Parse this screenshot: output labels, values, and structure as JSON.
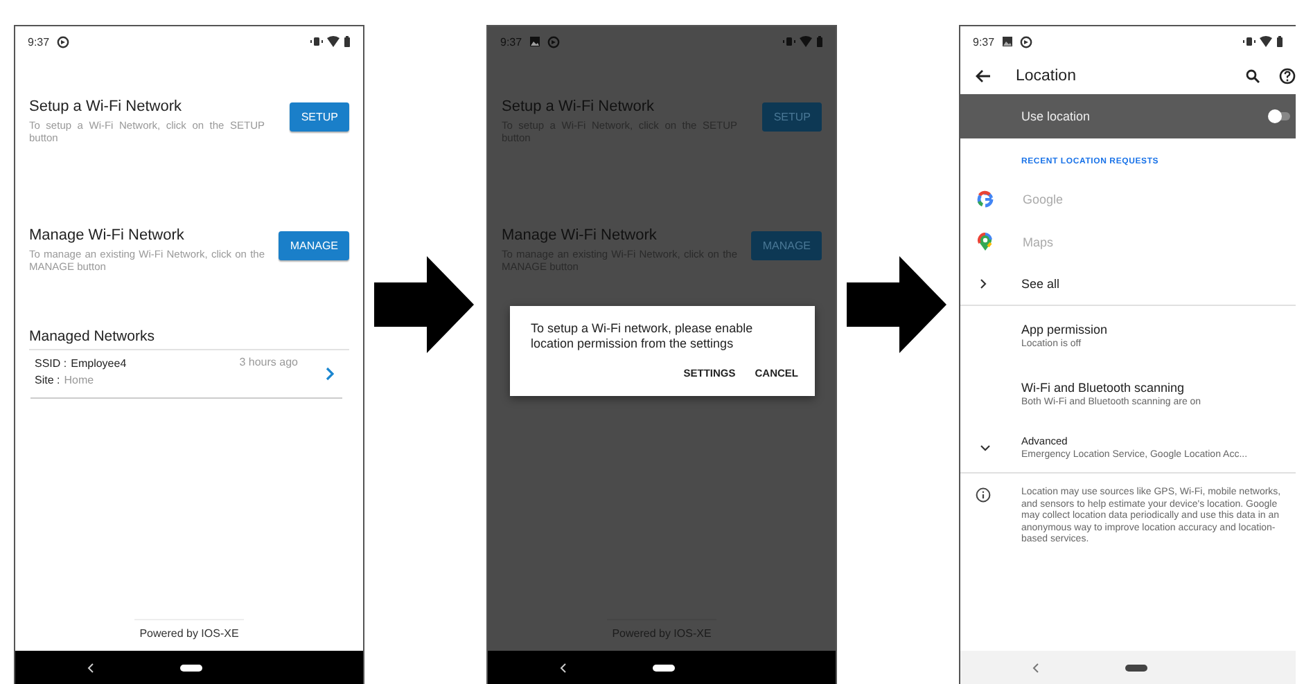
{
  "screens": [
    {
      "kind": "app",
      "dimmed": false,
      "status_bar": {
        "time": "9:37",
        "image_notification": false
      },
      "sections": [
        {
          "title": "Setup a Wi-Fi Network",
          "description": "To setup a Wi-Fi Network, click on the SETUP button",
          "button": "SETUP"
        },
        {
          "title": "Manage Wi-Fi Network",
          "description": "To manage an existing Wi-Fi Network, click on the MANAGE button",
          "button": "MANAGE"
        }
      ],
      "managed": {
        "title": "Managed Networks",
        "items": [
          {
            "ssid_label": "SSID :",
            "ssid": "Employee4",
            "site_label": "Site :",
            "site": "Home",
            "time": "3 hours ago"
          }
        ]
      },
      "footer": "Powered by IOS-XE"
    },
    {
      "kind": "app",
      "dimmed": true,
      "status_bar": {
        "time": "9:37",
        "image_notification": true
      },
      "sections": [
        {
          "title": "Setup a Wi-Fi Network",
          "description": "To setup a Wi-Fi Network, click on the SETUP button",
          "button": "SETUP"
        },
        {
          "title": "Manage Wi-Fi Network",
          "description": "To manage an existing Wi-Fi Network, click on the MANAGE button",
          "button": "MANAGE"
        }
      ],
      "dialog": {
        "message": "To setup a Wi-Fi network, please enable location permission from the settings",
        "buttons": [
          "SETTINGS",
          "CANCEL"
        ]
      },
      "footer": "Powered by IOS-XE"
    },
    {
      "kind": "settings",
      "status_bar": {
        "time": "9:37",
        "image_notification": true
      },
      "title": "Location",
      "use_location": {
        "label": "Use location",
        "on": false
      },
      "section_header": "RECENT LOCATION REQUESTS",
      "apps": [
        {
          "name": "Google",
          "disabled": true
        },
        {
          "name": "Maps",
          "disabled": true
        }
      ],
      "items": [
        {
          "kind": "link",
          "title": "See all"
        },
        {
          "kind": "divider"
        },
        {
          "kind": "entry",
          "title": "App permission",
          "subtitle": "Location is off"
        },
        {
          "kind": "entry",
          "title": "Wi-Fi and Bluetooth scanning",
          "subtitle": "Both Wi-Fi and Bluetooth scanning are on"
        },
        {
          "kind": "expandable",
          "title": "Advanced",
          "subtitle": "Emergency Location Service, Google Location Acc..."
        },
        {
          "kind": "divider"
        }
      ],
      "info": "Location may use sources like GPS, Wi-Fi, mobile networks, and sensors to help estimate your device's location. Google may collect location data periodically and use this data in an anonymous way to improve location accuracy and location-based services."
    }
  ]
}
